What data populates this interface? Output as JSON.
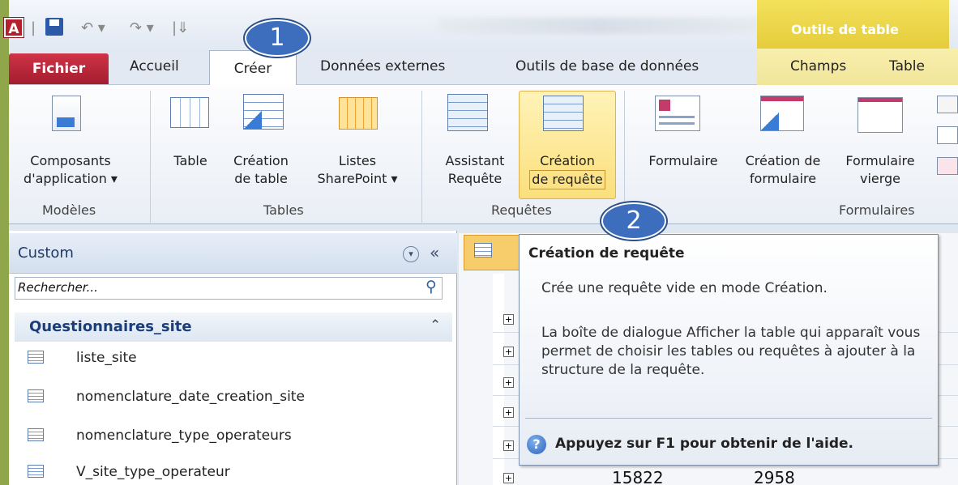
{
  "app": {
    "icon_letter": "A",
    "context_title": "Outils de table"
  },
  "tabs": [
    "Fichier",
    "Accueil",
    "Créer",
    "Données externes",
    "Outils de base de données",
    "Champs",
    "Table"
  ],
  "ribbon": {
    "buttons": {
      "composants": [
        "Composants",
        "d'application ▾"
      ],
      "table": "Table",
      "creation_table": [
        "Création",
        "de table"
      ],
      "listes_sharepoint": [
        "Listes",
        "SharePoint ▾"
      ],
      "assistant_requete": [
        "Assistant",
        "Requête"
      ],
      "creation_requete": [
        "Création",
        "de requête"
      ],
      "formulaire": "Formulaire",
      "creation_formulaire": [
        "Création de",
        "formulaire"
      ],
      "formulaire_vierge": [
        "Formulaire",
        "vierge"
      ]
    },
    "groups": [
      "Modèles",
      "Tables",
      "Requêtes",
      "Formulaires"
    ]
  },
  "nav": {
    "title": "Custom",
    "search_placeholder": "Rechercher...",
    "group": "Questionnaires_site",
    "items": [
      "liste_site",
      "nomenclature_date_creation_site",
      "nomenclature_type_operateurs",
      "V_site_type_operateur"
    ]
  },
  "tooltip": {
    "title": "Création de requête",
    "description": "Crée une requête vide en mode Création.",
    "body": "La boîte de dialogue Afficher la table qui apparaît vous permet de choisir les tables ou requêtes à ajouter à la structure de la requête.",
    "help": "Appuyez sur F1 pour obtenir de l'aide."
  },
  "sheet": {
    "values": [
      "15822",
      "2958"
    ]
  },
  "callouts": [
    "1",
    "2"
  ]
}
